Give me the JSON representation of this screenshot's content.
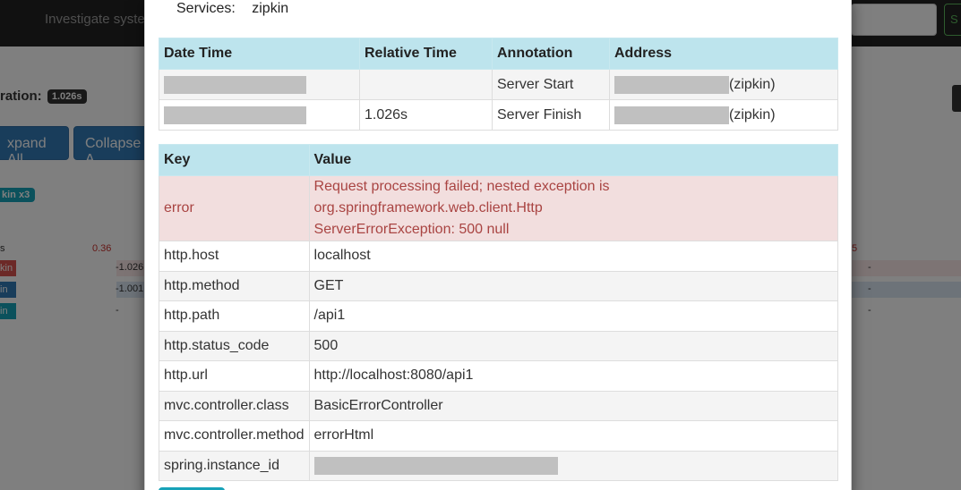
{
  "background": {
    "nav_text": "Investigate system",
    "nav_button": "S",
    "duration_label": "ration:",
    "duration_value": "1.026s",
    "expand_all": "xpand All",
    "collapse_all": "Collapse A",
    "service_tag": "kin x3",
    "scale_left": "s",
    "scale_mid": "0.36",
    "scale_right": "5",
    "spans": [
      {
        "label": "kin",
        "duration": "-1.026"
      },
      {
        "label": "in",
        "duration": "-1.001"
      },
      {
        "label": "in",
        "duration": "-"
      }
    ],
    "right_marks": [
      "-",
      "-",
      "-"
    ]
  },
  "modal": {
    "services_label": "Services:",
    "services_value": "zipkin",
    "annotations": {
      "headers": [
        "Date Time",
        "Relative Time",
        "Annotation",
        "Address"
      ],
      "rows": [
        {
          "date_time": "",
          "relative_time": "",
          "annotation": "Server Start",
          "address_suffix": "(zipkin)"
        },
        {
          "date_time": "",
          "relative_time": "1.026s",
          "annotation": "Server Finish",
          "address_suffix": "(zipkin)"
        }
      ]
    },
    "tags": {
      "headers": [
        "Key",
        "Value"
      ],
      "rows": [
        {
          "key": "error",
          "value_line1": "Request processing failed; nested exception is org.springframework.web.client.Http",
          "value_line2": "ServerErrorException: 500 null"
        },
        {
          "key": "http.host",
          "value": "localhost"
        },
        {
          "key": "http.method",
          "value": "GET"
        },
        {
          "key": "http.path",
          "value": "/api1"
        },
        {
          "key": "http.status_code",
          "value": "500"
        },
        {
          "key": "http.url",
          "value": "http://localhost:8080/api1"
        },
        {
          "key": "mvc.controller.class",
          "value": "BasicErrorController"
        },
        {
          "key": "mvc.controller.method",
          "value": "errorHtml"
        },
        {
          "key": "spring.instance_id",
          "value": ""
        }
      ]
    }
  },
  "colors": {
    "table_header": "#bde4ed",
    "error_row": "#f2dede",
    "error_text": "#a94442",
    "primary": "#337ab7",
    "info": "#17a2b8"
  }
}
